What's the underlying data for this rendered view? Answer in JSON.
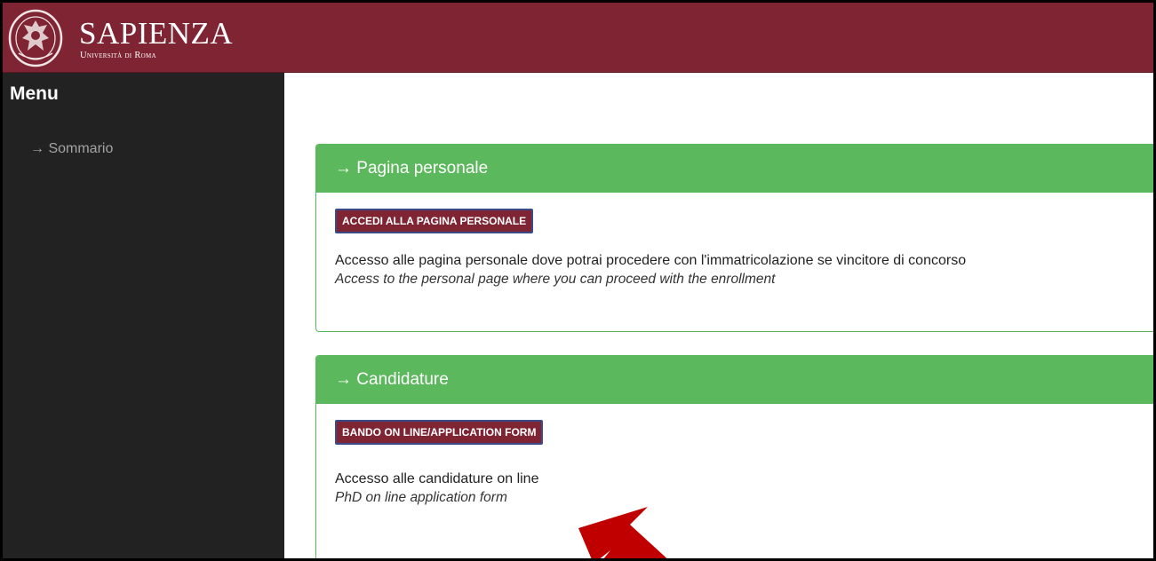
{
  "header": {
    "brand_name": "SAPIENZA",
    "brand_subtitle": "Università di Roma",
    "colors": {
      "brand": "#7f2433"
    }
  },
  "sidebar": {
    "title": "Menu",
    "items": [
      {
        "label": "→ Sommario"
      }
    ]
  },
  "panels": [
    {
      "heading": "→ Pagina personale",
      "button": "ACCEDI ALLA PAGINA PERSONALE",
      "description_it": "Accesso alle pagina personale dove potrai procedere con l'immatricolazione se vincitore di concorso",
      "description_en": "Access to the personal page where you can proceed with the enrollment"
    },
    {
      "heading": "→ Candidature",
      "button": "BANDO ON LINE/APPLICATION FORM",
      "description_it": "Accesso alle candidature on line",
      "description_en": "PhD on line application form"
    }
  ],
  "colors": {
    "panel_green": "#5cb85c",
    "sidebar_bg": "#222222",
    "annotation_arrow": "#c00000"
  }
}
